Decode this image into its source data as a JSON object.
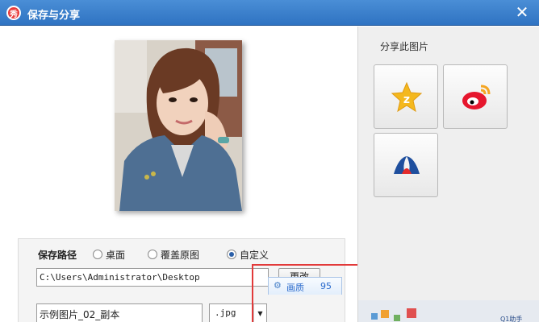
{
  "window": {
    "title": "保存与分享",
    "app_icon_glyph": "秀",
    "close_glyph": "✕"
  },
  "photo": {
    "description_icon": "portrait-photo"
  },
  "save_settings": {
    "path_label": "保存路径",
    "options": [
      {
        "label": "桌面",
        "selected": false
      },
      {
        "label": "覆盖原图",
        "selected": false
      },
      {
        "label": "自定义",
        "selected": true
      }
    ],
    "path_value": "C:\\Users\\Administrator\\Desktop",
    "change_button": "更改",
    "filename_value": "示例图片_02_副本",
    "extension_value": ".jpg",
    "quality_label": "画质",
    "quality_value": "95"
  },
  "share": {
    "title": "分享此图片",
    "targets": [
      {
        "icon": "qzone-icon"
      },
      {
        "icon": "weibo-icon"
      },
      {
        "icon": "renren-icon"
      }
    ]
  },
  "ad": {
    "text": "Q1助手"
  },
  "colors": {
    "titlebar": "#3a80cc",
    "highlight": "#e23a3a",
    "accent": "#2a6acc"
  }
}
